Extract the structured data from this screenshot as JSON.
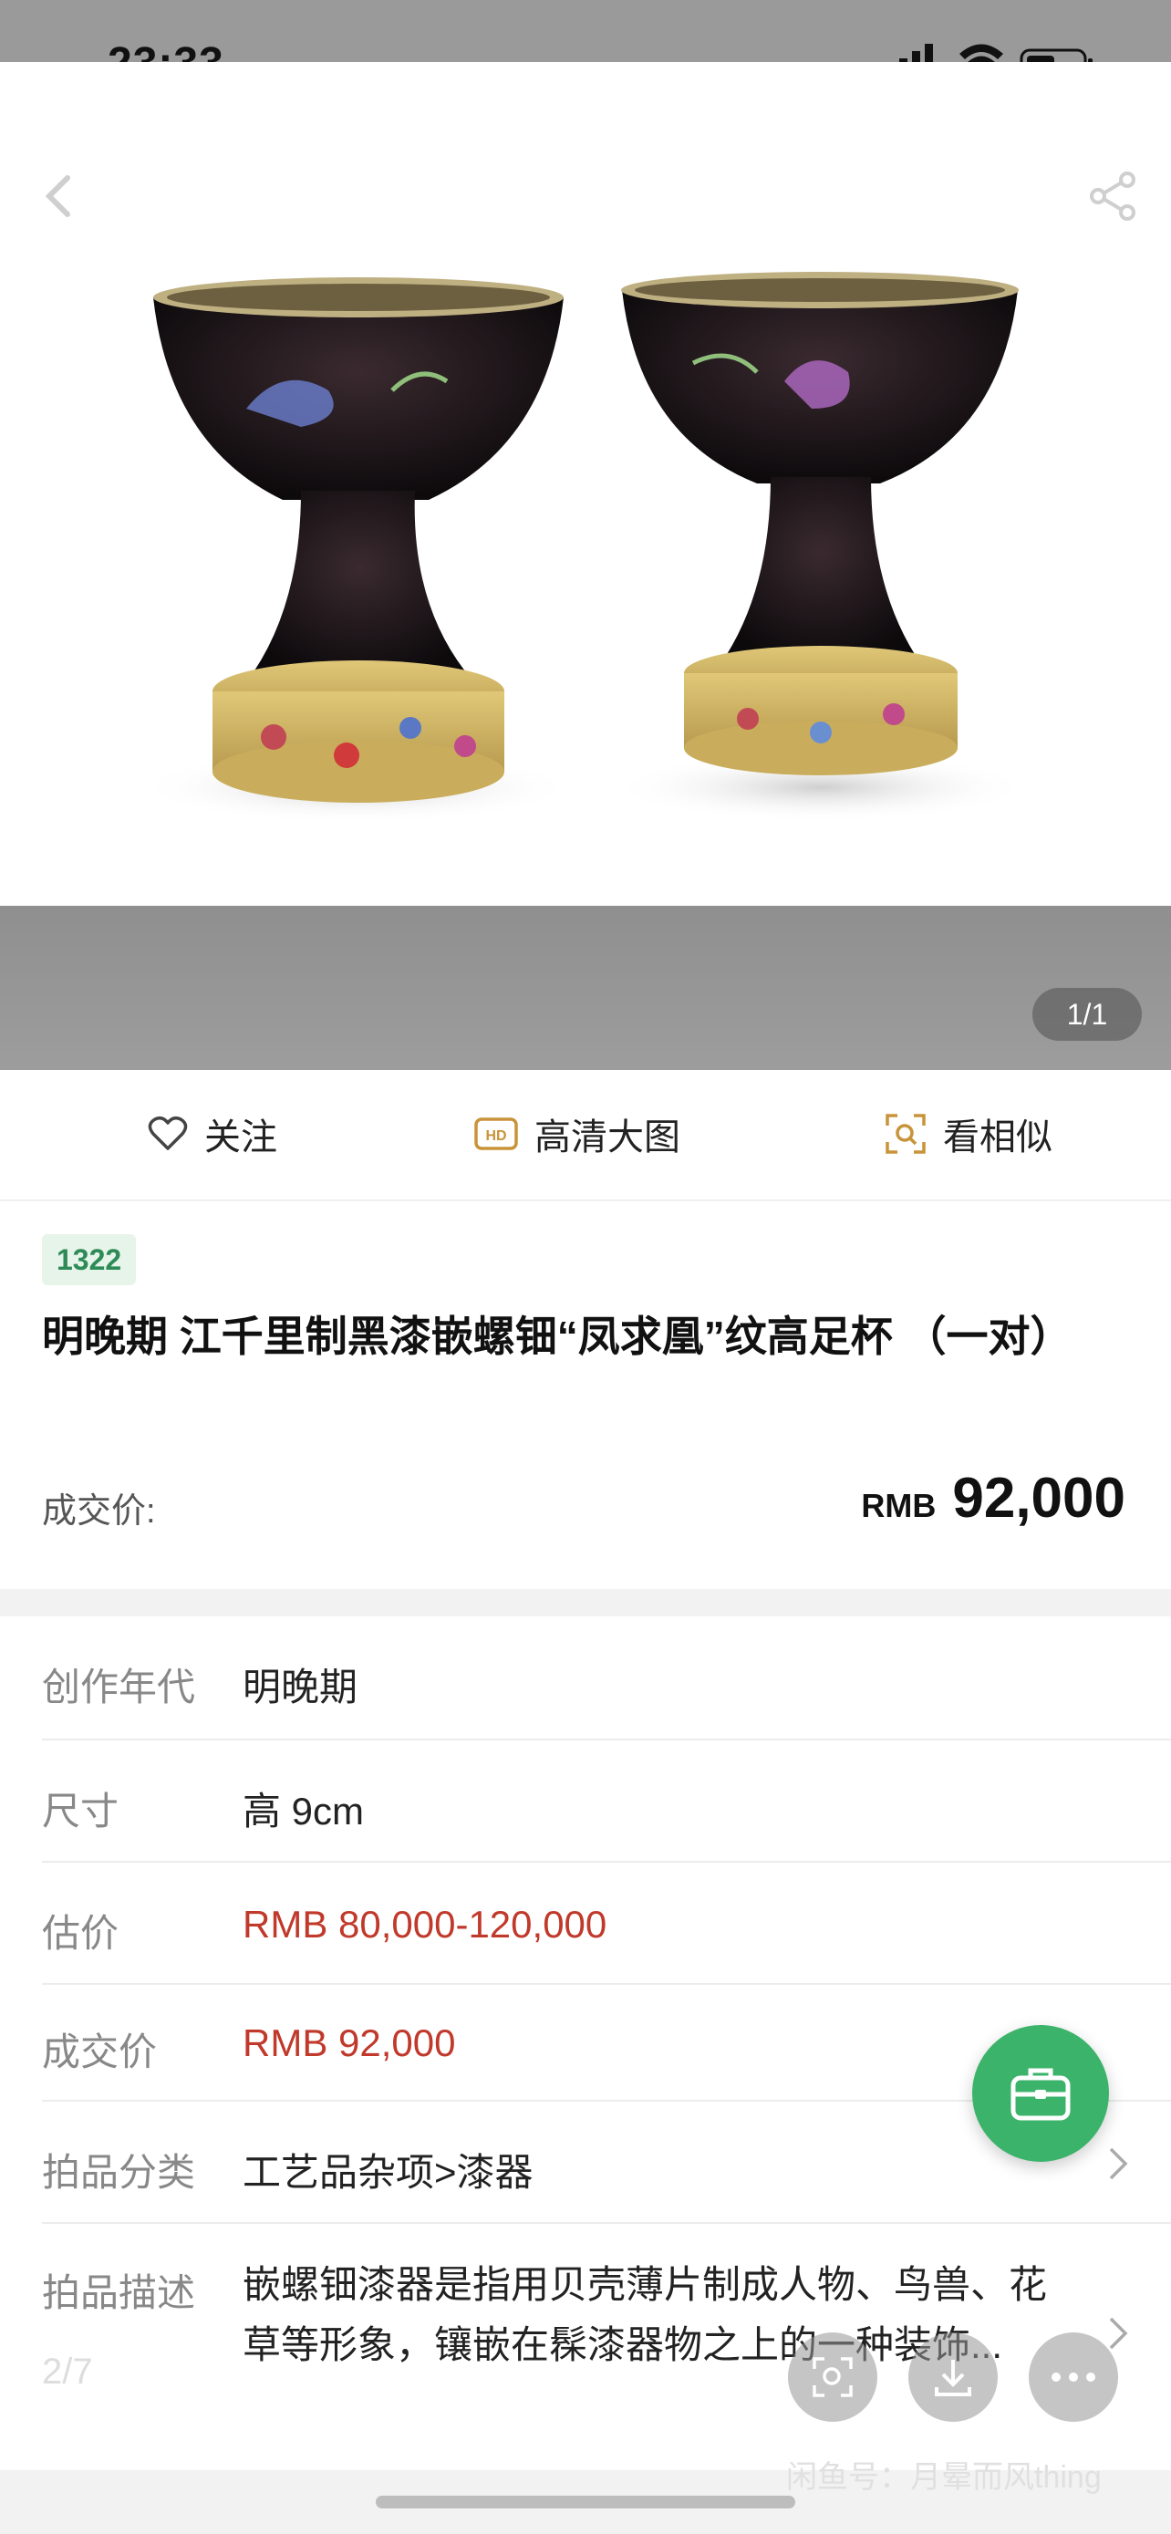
{
  "status_bar": {
    "time": "23:33"
  },
  "hero": {
    "image_counter": "1/1",
    "image_description_name": "lacquer-stem-cups-photo"
  },
  "actions": {
    "follow": "关注",
    "hd_image": "高清大图",
    "similar": "看相似"
  },
  "lot": {
    "number": "1322",
    "title": "明晚期 江千里制黑漆嵌螺钿“凤求凰”纹高足杯 （一对）",
    "deal_label": "成交价:",
    "deal_currency": "RMB",
    "deal_amount": "92,000"
  },
  "details": [
    {
      "label": "创作年代",
      "value": "明晚期"
    },
    {
      "label": "尺寸",
      "value": "高 9cm"
    },
    {
      "label": "估价",
      "value": "RMB  80,000-120,000"
    },
    {
      "label": "成交价",
      "value": "RMB 92,000"
    },
    {
      "label": "拍品分类",
      "value": "工艺品杂项>漆器"
    },
    {
      "label": "拍品描述",
      "value": "嵌螺钿漆器是指用贝壳薄片制成人物、鸟兽、花草等形象，镶嵌在髹漆器物之上的一种装饰..."
    }
  ],
  "pager": "2/7",
  "watermark": "闲鱼号：月晕而风thing",
  "colors": {
    "accent_green": "#3cb36a",
    "price_red": "#c0392b"
  }
}
